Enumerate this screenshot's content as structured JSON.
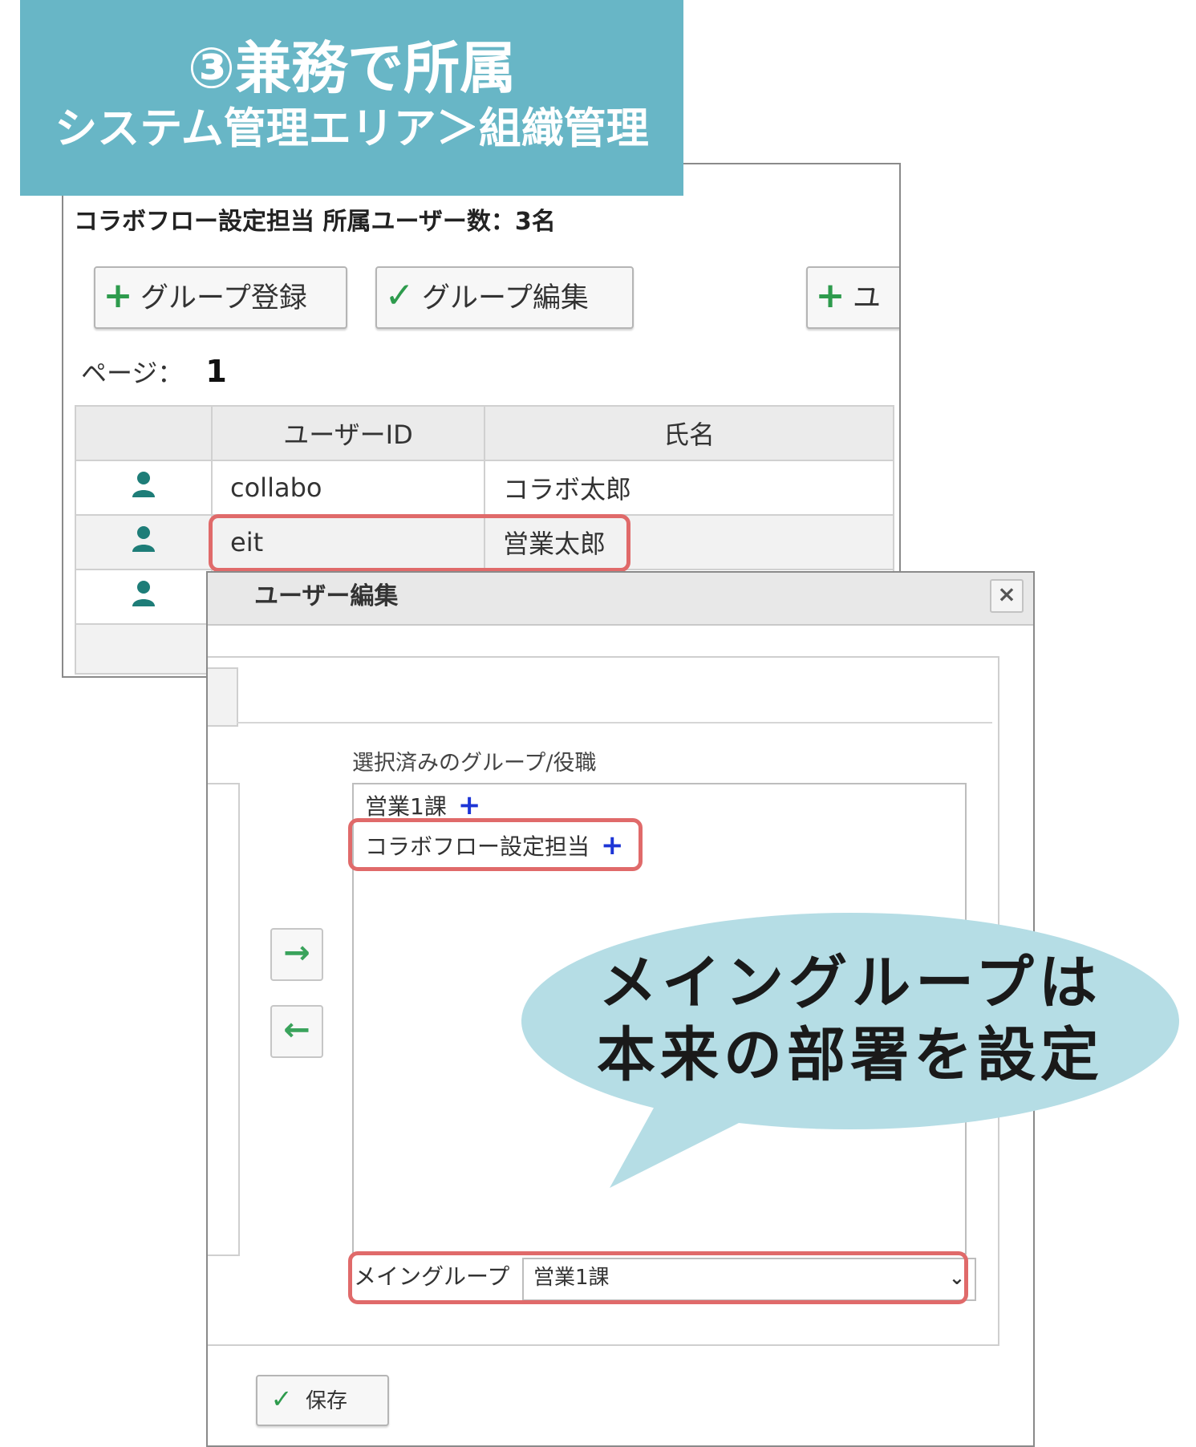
{
  "banner": {
    "title": "③兼務で所属",
    "subtitle": "システム管理エリア＞組織管理"
  },
  "group_view": {
    "title": "コラボフロー設定担当 所属ユーザー数：3名",
    "buttons": {
      "register": {
        "icon": "plus-icon",
        "label": "グループ登録"
      },
      "edit": {
        "icon": "check-icon",
        "label": "グループ編集"
      },
      "add_partial": {
        "icon": "plus-icon",
        "label": "ユ"
      }
    },
    "page_label": "ページ：",
    "page_number": "1",
    "table": {
      "headers": [
        "",
        "ユーザーID",
        "氏名"
      ],
      "rows": [
        {
          "icon": "user-icon",
          "user_id": "collabo",
          "name": "コラボ太郎"
        },
        {
          "icon": "user-icon",
          "user_id": "eit",
          "name": "営業太郎"
        },
        {
          "icon": "user-icon",
          "user_id": "",
          "name": ""
        }
      ]
    }
  },
  "dialog": {
    "title": "ユーザー編集",
    "close_icon": "close-icon",
    "selected_label": "選択済みのグループ/役職",
    "selected_items": [
      {
        "label": "営業1課",
        "add_symbol": "+"
      },
      {
        "label": "コラボフロー設定担当",
        "add_symbol": "+"
      }
    ],
    "arrows": {
      "right": "→",
      "left": "←"
    },
    "main_group_label": "メイングループ",
    "main_group_value": "営業1課",
    "save_label": "保存"
  },
  "callout": {
    "line1": "メイングループは",
    "line2": "本来の部署を設定"
  },
  "colors": {
    "banner": "#68b6c6",
    "highlight": "#e06a6a",
    "bubble": "#b5dde5",
    "accent_green": "#2e9b4d",
    "user_icon": "#1e7d78",
    "plus_blue": "#1d35d6"
  }
}
